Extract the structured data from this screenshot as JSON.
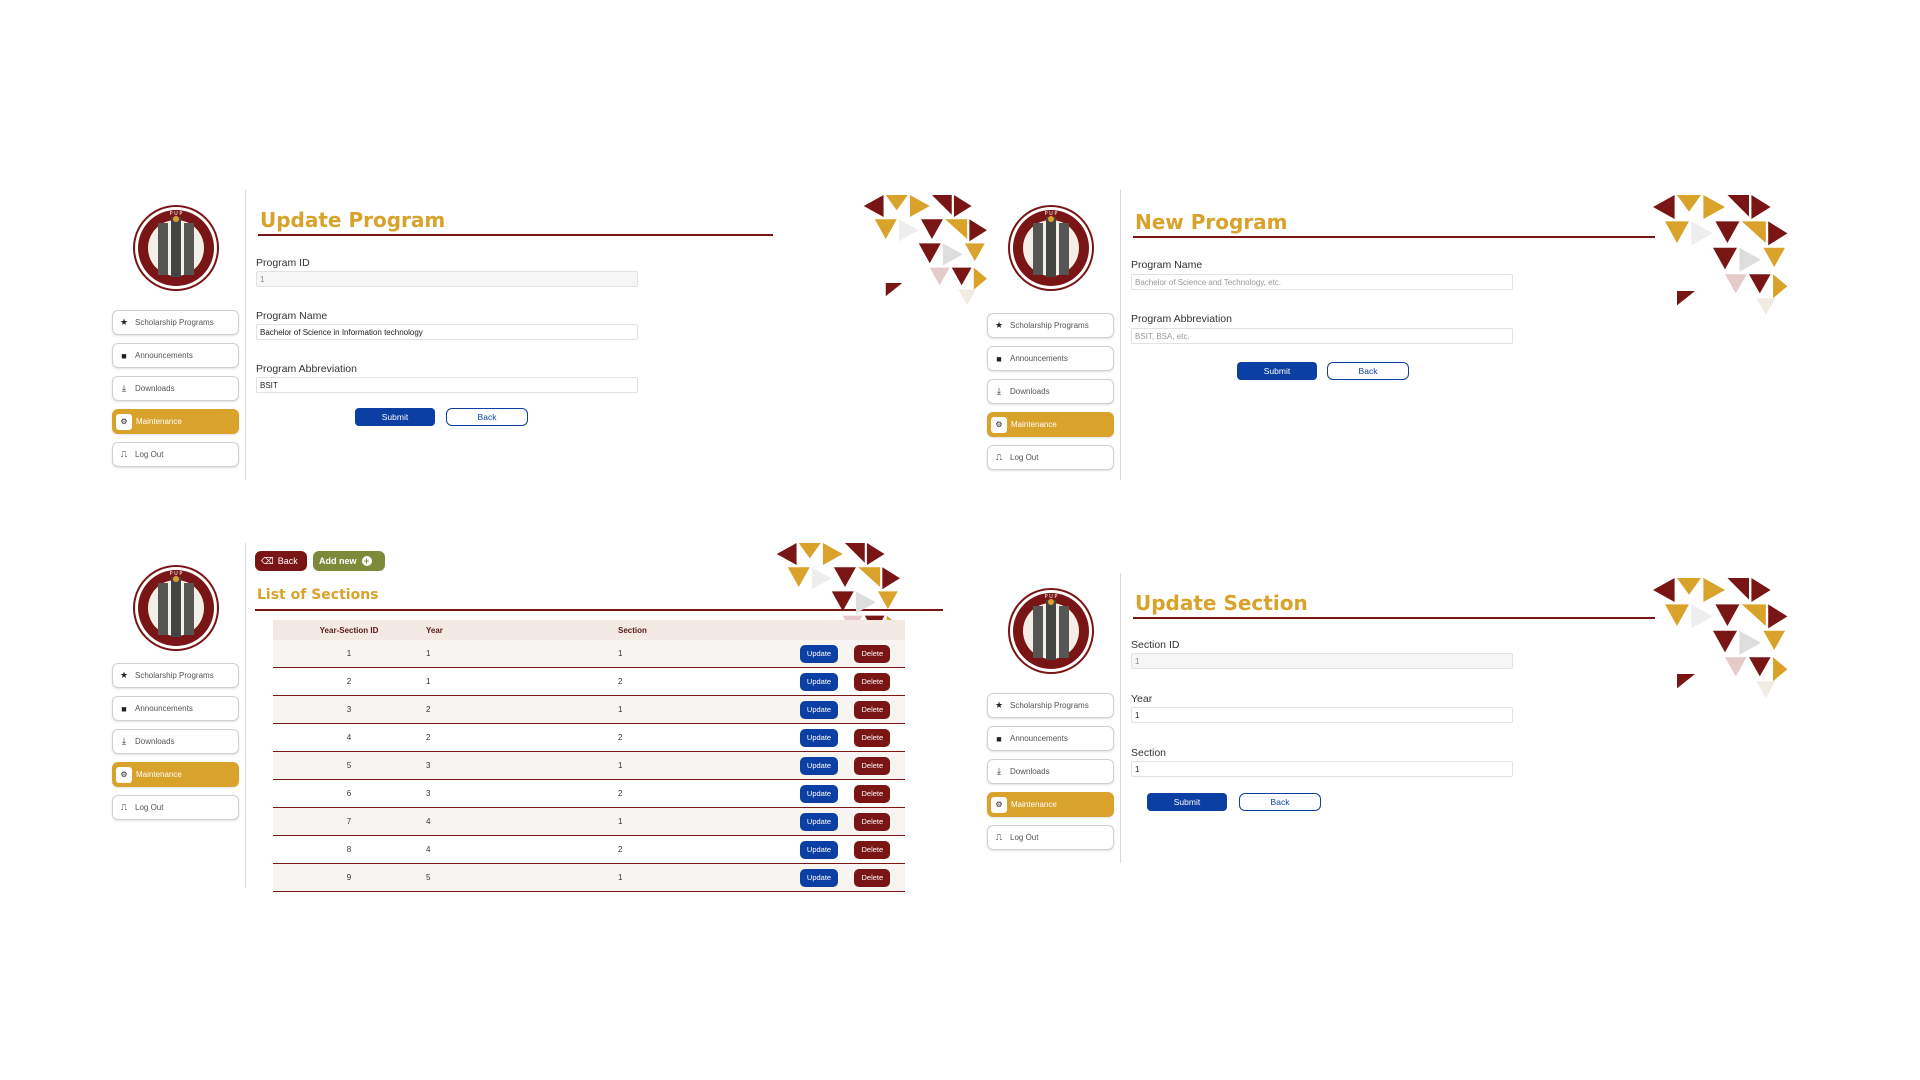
{
  "sidebar": {
    "items": [
      {
        "label": "Scholarship Programs",
        "icon": "star-icon"
      },
      {
        "label": "Announcements",
        "icon": "note-icon"
      },
      {
        "label": "Downloads",
        "icon": "download-icon"
      },
      {
        "label": "Maintenance",
        "icon": "gears-icon"
      },
      {
        "label": "Log Out",
        "icon": "door-icon"
      }
    ],
    "active": "Maintenance"
  },
  "colors": {
    "gold": "#d9a22a",
    "maroon": "#7a1515",
    "blue": "#0b3fa3",
    "olive": "#7c8a3a"
  },
  "update_program": {
    "title": "Update Program",
    "id_label": "Program ID",
    "id_value": "1",
    "name_label": "Program Name",
    "name_value": "Bachelor of Science in Information technology",
    "abbr_label": "Program Abbreviation",
    "abbr_value": "BSIT",
    "submit": "Submit",
    "back": "Back"
  },
  "new_program": {
    "title": "New Program",
    "name_label": "Program Name",
    "name_placeholder": "Bachelor of Science and Technology, etc.",
    "abbr_label": "Program Abbreviation",
    "abbr_placeholder": "BSIT, BSA, etc.",
    "submit": "Submit",
    "back": "Back"
  },
  "sections_list": {
    "back": "Back",
    "add_new": "Add new",
    "title": "List of Sections",
    "columns": [
      "Year-Section ID",
      "Year",
      "Section"
    ],
    "update_label": "Update",
    "delete_label": "Delete",
    "rows": [
      [
        "1",
        "1",
        "1"
      ],
      [
        "2",
        "1",
        "2"
      ],
      [
        "3",
        "2",
        "1"
      ],
      [
        "4",
        "2",
        "2"
      ],
      [
        "5",
        "3",
        "1"
      ],
      [
        "6",
        "3",
        "2"
      ],
      [
        "7",
        "4",
        "1"
      ],
      [
        "8",
        "4",
        "2"
      ],
      [
        "9",
        "5",
        "1"
      ]
    ]
  },
  "update_section": {
    "title": "Update Section",
    "id_label": "Section ID",
    "id_value": "1",
    "year_label": "Year",
    "year_value": "1",
    "section_label": "Section",
    "section_value": "1",
    "submit": "Submit",
    "back": "Back"
  }
}
